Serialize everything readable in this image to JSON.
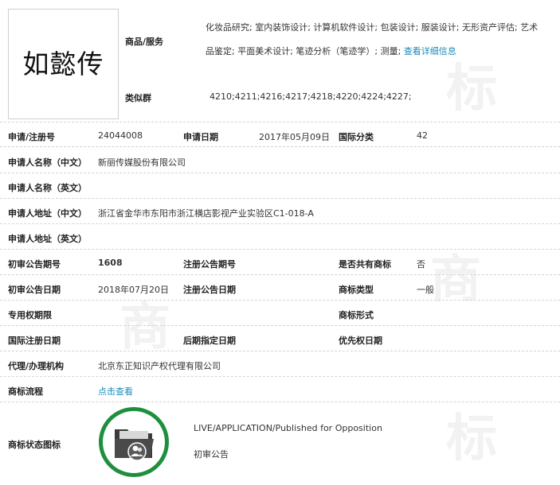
{
  "trademark": {
    "name": "如懿传"
  },
  "goods_services": {
    "label": "商品/服务",
    "line1": "化妆品研究; 室内装饰设计; 计算机软件设计; 包装设计; 服装设计; 无形资产评估; 艺术",
    "line2": "品鉴定; 平面美术设计; 笔迹分析（笔迹学）; 测量;",
    "more_link": "查看详细信息"
  },
  "similar_group": {
    "label": "类似群",
    "value": "4210;4211;4216;4217;4218;4220;4224;4227;"
  },
  "rows": {
    "reg_no": {
      "label": "申请/注册号",
      "value": "24044008"
    },
    "apply_date": {
      "label": "申请日期",
      "value": "2017年05月09日"
    },
    "intl_class": {
      "label": "国际分类",
      "value": "42"
    },
    "applicant_cn": {
      "label": "申请人名称（中文）",
      "value": "新丽传媒股份有限公司"
    },
    "applicant_en": {
      "label": "申请人名称（英文）",
      "value": ""
    },
    "address_cn": {
      "label": "申请人地址（中文）",
      "value": "浙江省金华市东阳市浙江横店影视产业实验区C1-018-A"
    },
    "address_en": {
      "label": "申请人地址（英文）",
      "value": ""
    },
    "prelim_issue": {
      "label": "初审公告期号",
      "value": "1608"
    },
    "reg_issue": {
      "label": "注册公告期号",
      "value": ""
    },
    "shared": {
      "label": "是否共有商标",
      "value": "否"
    },
    "prelim_date": {
      "label": "初审公告日期",
      "value": "2018年07月20日"
    },
    "reg_date": {
      "label": "注册公告日期",
      "value": ""
    },
    "tm_type": {
      "label": "商标类型",
      "value": "一般"
    },
    "exclusive_period": {
      "label": "专用权期限",
      "value": ""
    },
    "tm_form": {
      "label": "商标形式",
      "value": ""
    },
    "intl_reg_date": {
      "label": "国际注册日期",
      "value": ""
    },
    "later_date": {
      "label": "后期指定日期",
      "value": ""
    },
    "priority_date": {
      "label": "优先权日期",
      "value": ""
    },
    "agent": {
      "label": "代理/办理机构",
      "value": "北京东正知识产权代理有限公司"
    },
    "flow": {
      "label": "商标流程",
      "link": "点击查看"
    }
  },
  "status": {
    "label": "商标状态图标",
    "line1": "LIVE/APPLICATION/Published for Opposition",
    "line2": "初审公告",
    "icon": "folder-user-icon",
    "ring_color": "#1e8f3f"
  },
  "colors": {
    "link": "#1a8cb8",
    "divider": "#d4d4d4"
  }
}
